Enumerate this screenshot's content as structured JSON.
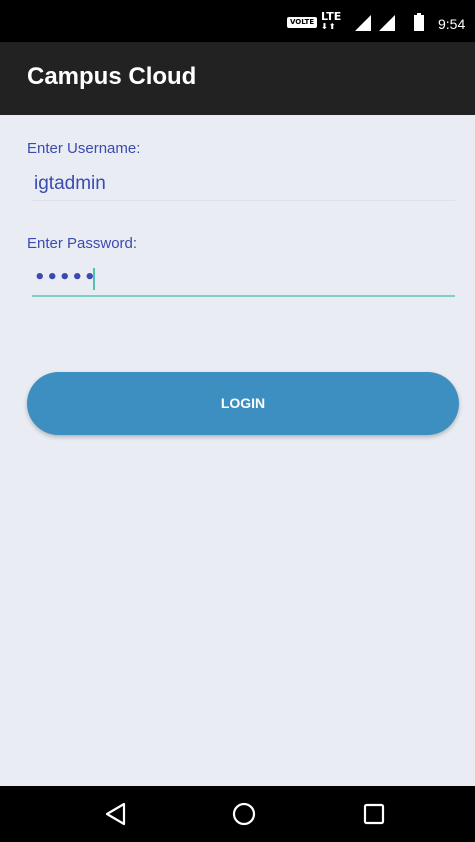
{
  "status_bar": {
    "volte_label": "VOLTE",
    "network_label": "LTE",
    "time": "9:54",
    "icons": [
      "volte-icon",
      "lte-icon",
      "signal-icon",
      "signal-icon",
      "battery-icon"
    ]
  },
  "app_bar": {
    "title": "Campus Cloud"
  },
  "login_form": {
    "username_label": "Enter Username:",
    "username_value": "igtadmin",
    "password_label": "Enter Password:",
    "password_value": "•••••",
    "login_label": "LOGIN"
  },
  "nav_bar": {
    "icons": [
      "back-icon",
      "home-icon",
      "recents-icon"
    ]
  },
  "colors": {
    "background": "#e9edf3",
    "app_bar": "#222222",
    "accent_text": "#3b4ab0",
    "focus_underline": "#7ccfc7",
    "button": "#3d8fc1"
  }
}
